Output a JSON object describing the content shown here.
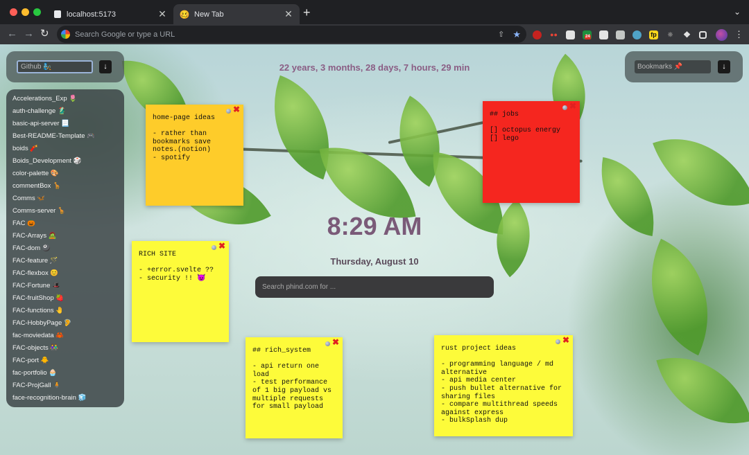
{
  "browser": {
    "tabs": [
      {
        "title": "localhost:5173",
        "icon": "page-icon",
        "active": false
      },
      {
        "title": "New Tab",
        "icon": "smiley-icon",
        "active": true
      }
    ],
    "new_tab_label": "+",
    "close_label": "✕",
    "omnibox_placeholder": "Search Google or type a URL",
    "extensions": [
      "ublock-icon",
      "glasses-icon",
      "tab-manager-icon",
      "notification-icon",
      "dark-reader-icon",
      "screenshot-icon",
      "globe-icon",
      "fp-icon",
      "bug-icon",
      "puzzle-icon",
      "sidebar-icon",
      "profile-avatar"
    ],
    "extension_badge": "24",
    "fp_label": "fp"
  },
  "github": {
    "placeholder": "Github 🧞",
    "button_icon": "↓"
  },
  "bookmarks": {
    "placeholder": "Bookmarks 📌",
    "button_icon": "↓"
  },
  "repos": [
    "Accelerations_Exp 🌷",
    "auth-challenge 🥻",
    "basic-api-server 📃",
    "Best-README-Template 🎮",
    "boids 🧨",
    "Boids_Development 🎲",
    "color-palette 🎨",
    "commentBox 🦒",
    "Comms 🦋",
    "Comms-server 🦒",
    "FAC 🎃",
    "FAC-Arrays 🧟",
    "FAC-dom 🎱",
    "FAC-feature 🪄",
    "FAC-flexbox 😊",
    "FAC-Fortune 🎩",
    "FAC-fruitShop 🍓",
    "FAC-functions 🤚",
    "FAC-HobbyPage 🦻",
    "fac-moviedata 🦀",
    "FAC-objects 👫",
    "FAC-port 🐥",
    "fac-portfolio 🧁",
    "FAC-ProjGall 🧍",
    "face-recognition-brain 🧊"
  ],
  "countdown": "22 years, 3 months, 28 days, 7 hours, 29 min",
  "clock": "8:29 AM",
  "date": "Thursday, August 10",
  "phind_placeholder": "Search phind.com for ...",
  "notes": [
    {
      "color": "#fecc2a",
      "text": "home-page ideas\n\n- rather than\nbookmarks save\nnotes.(notion)\n- spotify"
    },
    {
      "color": "#f5261f",
      "text": "## jobs\n\n[] octopus energy\n[] lego"
    },
    {
      "color": "#fdfb3a",
      "text": "RICH SITE\n\n- +error.svelte ??\n- security !! 😈"
    },
    {
      "color": "#fdfb3a",
      "text": "## rich_system\n\n- api return one\nload\n- test performance\nof 1 big payload vs\nmultiple requests\nfor small payload"
    },
    {
      "color": "#fdfb3a",
      "text": "rust project ideas\n\n- programming language / md\nalternative\n- api media center\n- push bullet alternative for\nsharing files\n- compare multithread speeds\nagainst express\n- bulkSplash dup"
    }
  ],
  "note_close_label": "✖"
}
